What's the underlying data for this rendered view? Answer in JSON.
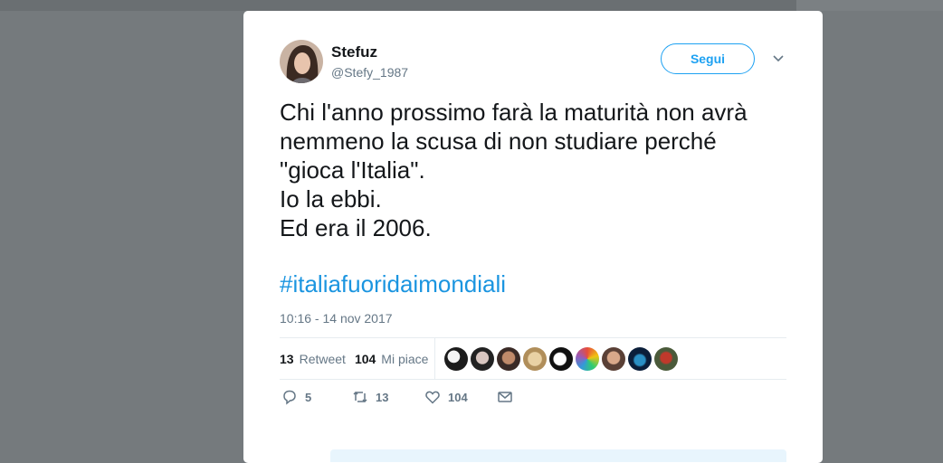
{
  "tweet": {
    "author": {
      "name": "Stefuz",
      "handle": "@Stefy_1987"
    },
    "follow_label": "Segui",
    "text_lines": [
      "Chi l'anno prossimo farà la maturità non avrà",
      "nemmeno la scusa di non studiare perché",
      "\"gioca l'Italia\".",
      "Io la ebbi.",
      "Ed era il 2006."
    ],
    "hashtag": "#italiafuoridaimondiali",
    "timestamp": "10:16 - 14 nov 2017",
    "stats": {
      "retweets_count": "13",
      "retweets_label": "Retweet",
      "likes_count": "104",
      "likes_label": "Mi piace"
    },
    "actions": {
      "replies": "5",
      "retweets": "13",
      "likes": "104"
    }
  },
  "colors": {
    "accent": "#1da1f2",
    "hashtag": "#1b95e0",
    "muted": "#657786",
    "text": "#14171a"
  },
  "icons": [
    "chevron-down-icon",
    "reply-icon",
    "retweet-icon",
    "heart-icon",
    "message-icon"
  ]
}
